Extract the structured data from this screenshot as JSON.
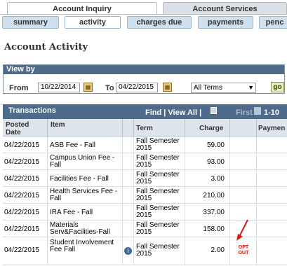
{
  "tabs": {
    "main": [
      {
        "label": "Account Inquiry",
        "active": true
      },
      {
        "label": "Account Services",
        "active": false
      }
    ],
    "sub": [
      {
        "label": "summary",
        "active": false
      },
      {
        "label": "activity",
        "active": true
      },
      {
        "label": "charges due",
        "active": false
      },
      {
        "label": "payments",
        "active": false
      },
      {
        "label": "penc",
        "active": false
      }
    ]
  },
  "page_title": "Account Activity",
  "view_by": {
    "header": "View by",
    "from_label": "From",
    "from_value": "10/22/2014",
    "to_label": "To",
    "to_value": "04/22/2015",
    "term_select": "All Terms",
    "go_label": "go"
  },
  "transactions": {
    "title": "Transactions",
    "find": "Find",
    "view_all": "View All",
    "sep": "|",
    "first": "First",
    "range": "1-10",
    "columns": {
      "posted_date": "Posted Date",
      "item": "Item",
      "term": "Term",
      "charge": "Charge",
      "payment": "Paymen"
    },
    "rows": [
      {
        "date": "04/22/2015",
        "item": "ASB Fee - Fall",
        "term": "Fall Semester 2015",
        "charge": "59.00"
      },
      {
        "date": "04/22/2015",
        "item": "Campus Union Fee - Fall",
        "term": "Fall Semester 2015",
        "charge": "93.00"
      },
      {
        "date": "04/22/2015",
        "item": "Facilities Fee - Fall",
        "term": "Fall Semester 2015",
        "charge": "3.00"
      },
      {
        "date": "04/22/2015",
        "item": "Health Services Fee - Fall",
        "term": "Fall Semester 2015",
        "charge": "210.00"
      },
      {
        "date": "04/22/2015",
        "item": "IRA Fee - Fall",
        "term": "Fall Semester 2015",
        "charge": "337.00"
      },
      {
        "date": "04/22/2015",
        "item": "Materials Serv&Facilities-Fall",
        "term": "Fall Semester 2015",
        "charge": "158.00"
      },
      {
        "date": "04/22/2015",
        "item": "Student Involvement Fee Fall",
        "term": "Fall Semester 2015",
        "charge": "2.00",
        "opt_out": "OPT OUT"
      }
    ]
  },
  "colors": {
    "header_blue": "#4e6b8b",
    "column_header_bg": "#dde4ec",
    "opt_out_red": "#d01010",
    "go_button": "#e9eec0"
  },
  "icons": [
    "calendar-icon",
    "dropdown-arrow-icon",
    "download-icon",
    "previous-page-icon",
    "info-icon",
    "red-arrow-icon"
  ]
}
